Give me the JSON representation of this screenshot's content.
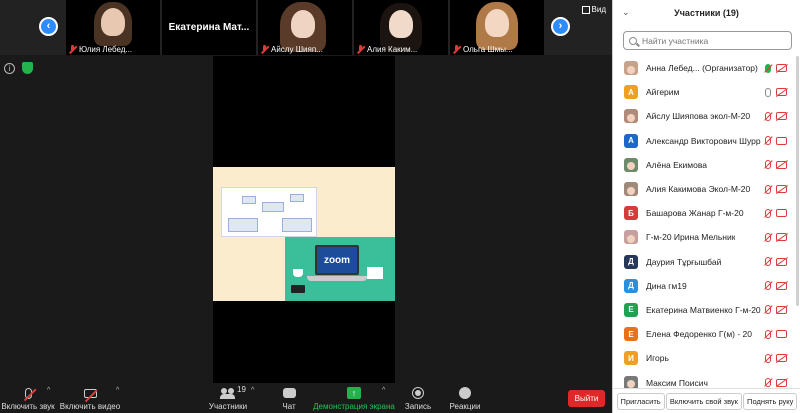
{
  "gallery": {
    "tiles": [
      {
        "name": "Юлия Лебед..."
      },
      {
        "name": "Екатерина  Мат..."
      },
      {
        "name": "Айслу Шияп..."
      },
      {
        "name": "Алия Каким..."
      },
      {
        "name": "Ольга Шмы..."
      }
    ],
    "view_label": "Вид"
  },
  "toolbar": {
    "unmute": "Включить звук",
    "start_video": "Включить видео",
    "participants": "Участники",
    "participants_count": "19",
    "chat": "Чат",
    "share_screen": "Демонстрация экрана",
    "record": "Запись",
    "reactions": "Реакции",
    "leave": "Выйти"
  },
  "slide": {
    "zoom_text": "zoom"
  },
  "panel": {
    "title": "Участники (19)",
    "search_placeholder": "Найти участника",
    "participants": [
      {
        "name": "Анна Лебед... (Организатор)",
        "avatar": "photo",
        "initial": "",
        "color": "#c8a38c",
        "mic": "green",
        "cam": "off"
      },
      {
        "name": "Айгерим",
        "avatar": "letter",
        "initial": "А",
        "color": "#f0a020",
        "mic": "on",
        "cam": "off"
      },
      {
        "name": "Айслу Шияпова экол-М-20",
        "avatar": "photo",
        "initial": "",
        "color": "#b08a7a",
        "mic": "off",
        "cam": "off"
      },
      {
        "name": "Александр Викторович Шурр",
        "avatar": "letter",
        "initial": "А",
        "color": "#1e66c9",
        "mic": "off",
        "cam": "on"
      },
      {
        "name": "Алёна Екимова",
        "avatar": "photo",
        "initial": "",
        "color": "#6b8b6b",
        "mic": "off",
        "cam": "off"
      },
      {
        "name": "Алия Какимова Экол-М-20",
        "avatar": "photo",
        "initial": "",
        "color": "#a0887a",
        "mic": "off",
        "cam": "off"
      },
      {
        "name": "Башарова Жанар Г-м-20",
        "avatar": "letter",
        "initial": "Б",
        "color": "#d73a3a",
        "mic": "off",
        "cam": "on"
      },
      {
        "name": "Г-м-20 Ирина Мельник",
        "avatar": "photo",
        "initial": "",
        "color": "#c79f9f",
        "mic": "off",
        "cam": "off"
      },
      {
        "name": "Даурия Тұрғышбай",
        "avatar": "letter",
        "initial": "Д",
        "color": "#26375a",
        "mic": "off",
        "cam": "off"
      },
      {
        "name": "Дина гм19",
        "avatar": "letter",
        "initial": "Д",
        "color": "#2b8fdf",
        "mic": "off",
        "cam": "off"
      },
      {
        "name": "Екатерина Матвиенко Г-м-20",
        "avatar": "letter",
        "initial": "Е",
        "color": "#23a050",
        "mic": "off",
        "cam": "off"
      },
      {
        "name": "Елена Федоренко Г(м) - 20",
        "avatar": "letter",
        "initial": "Е",
        "color": "#e8711a",
        "mic": "off",
        "cam": "on"
      },
      {
        "name": "Игорь",
        "avatar": "letter",
        "initial": "И",
        "color": "#f0a020",
        "mic": "off",
        "cam": "off"
      },
      {
        "name": "Максим Поисич",
        "avatar": "photo",
        "initial": "",
        "color": "#777777",
        "mic": "off",
        "cam": "off"
      }
    ],
    "footer": {
      "invite": "Пригласить",
      "unmute_self": "Включить свой звук",
      "raise_hand": "Поднять руку"
    }
  }
}
